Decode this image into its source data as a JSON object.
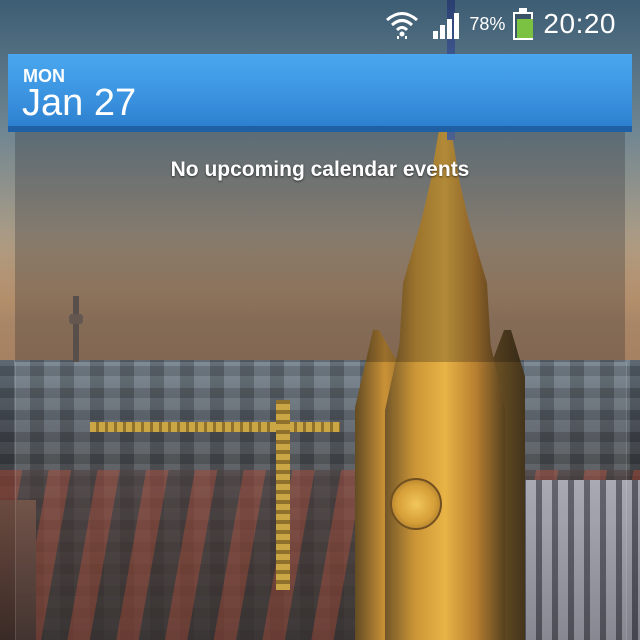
{
  "status_bar": {
    "battery_percent": "78%",
    "battery_level": 0.78,
    "time": "20:20",
    "icons": [
      "wifi-icon",
      "signal-icon",
      "battery-icon"
    ],
    "battery_color": "#7cc242"
  },
  "calendar_widget": {
    "day": "MON",
    "date": "Jan 27",
    "empty_message": "No upcoming calendar events",
    "header_color": "#3b93e0"
  }
}
